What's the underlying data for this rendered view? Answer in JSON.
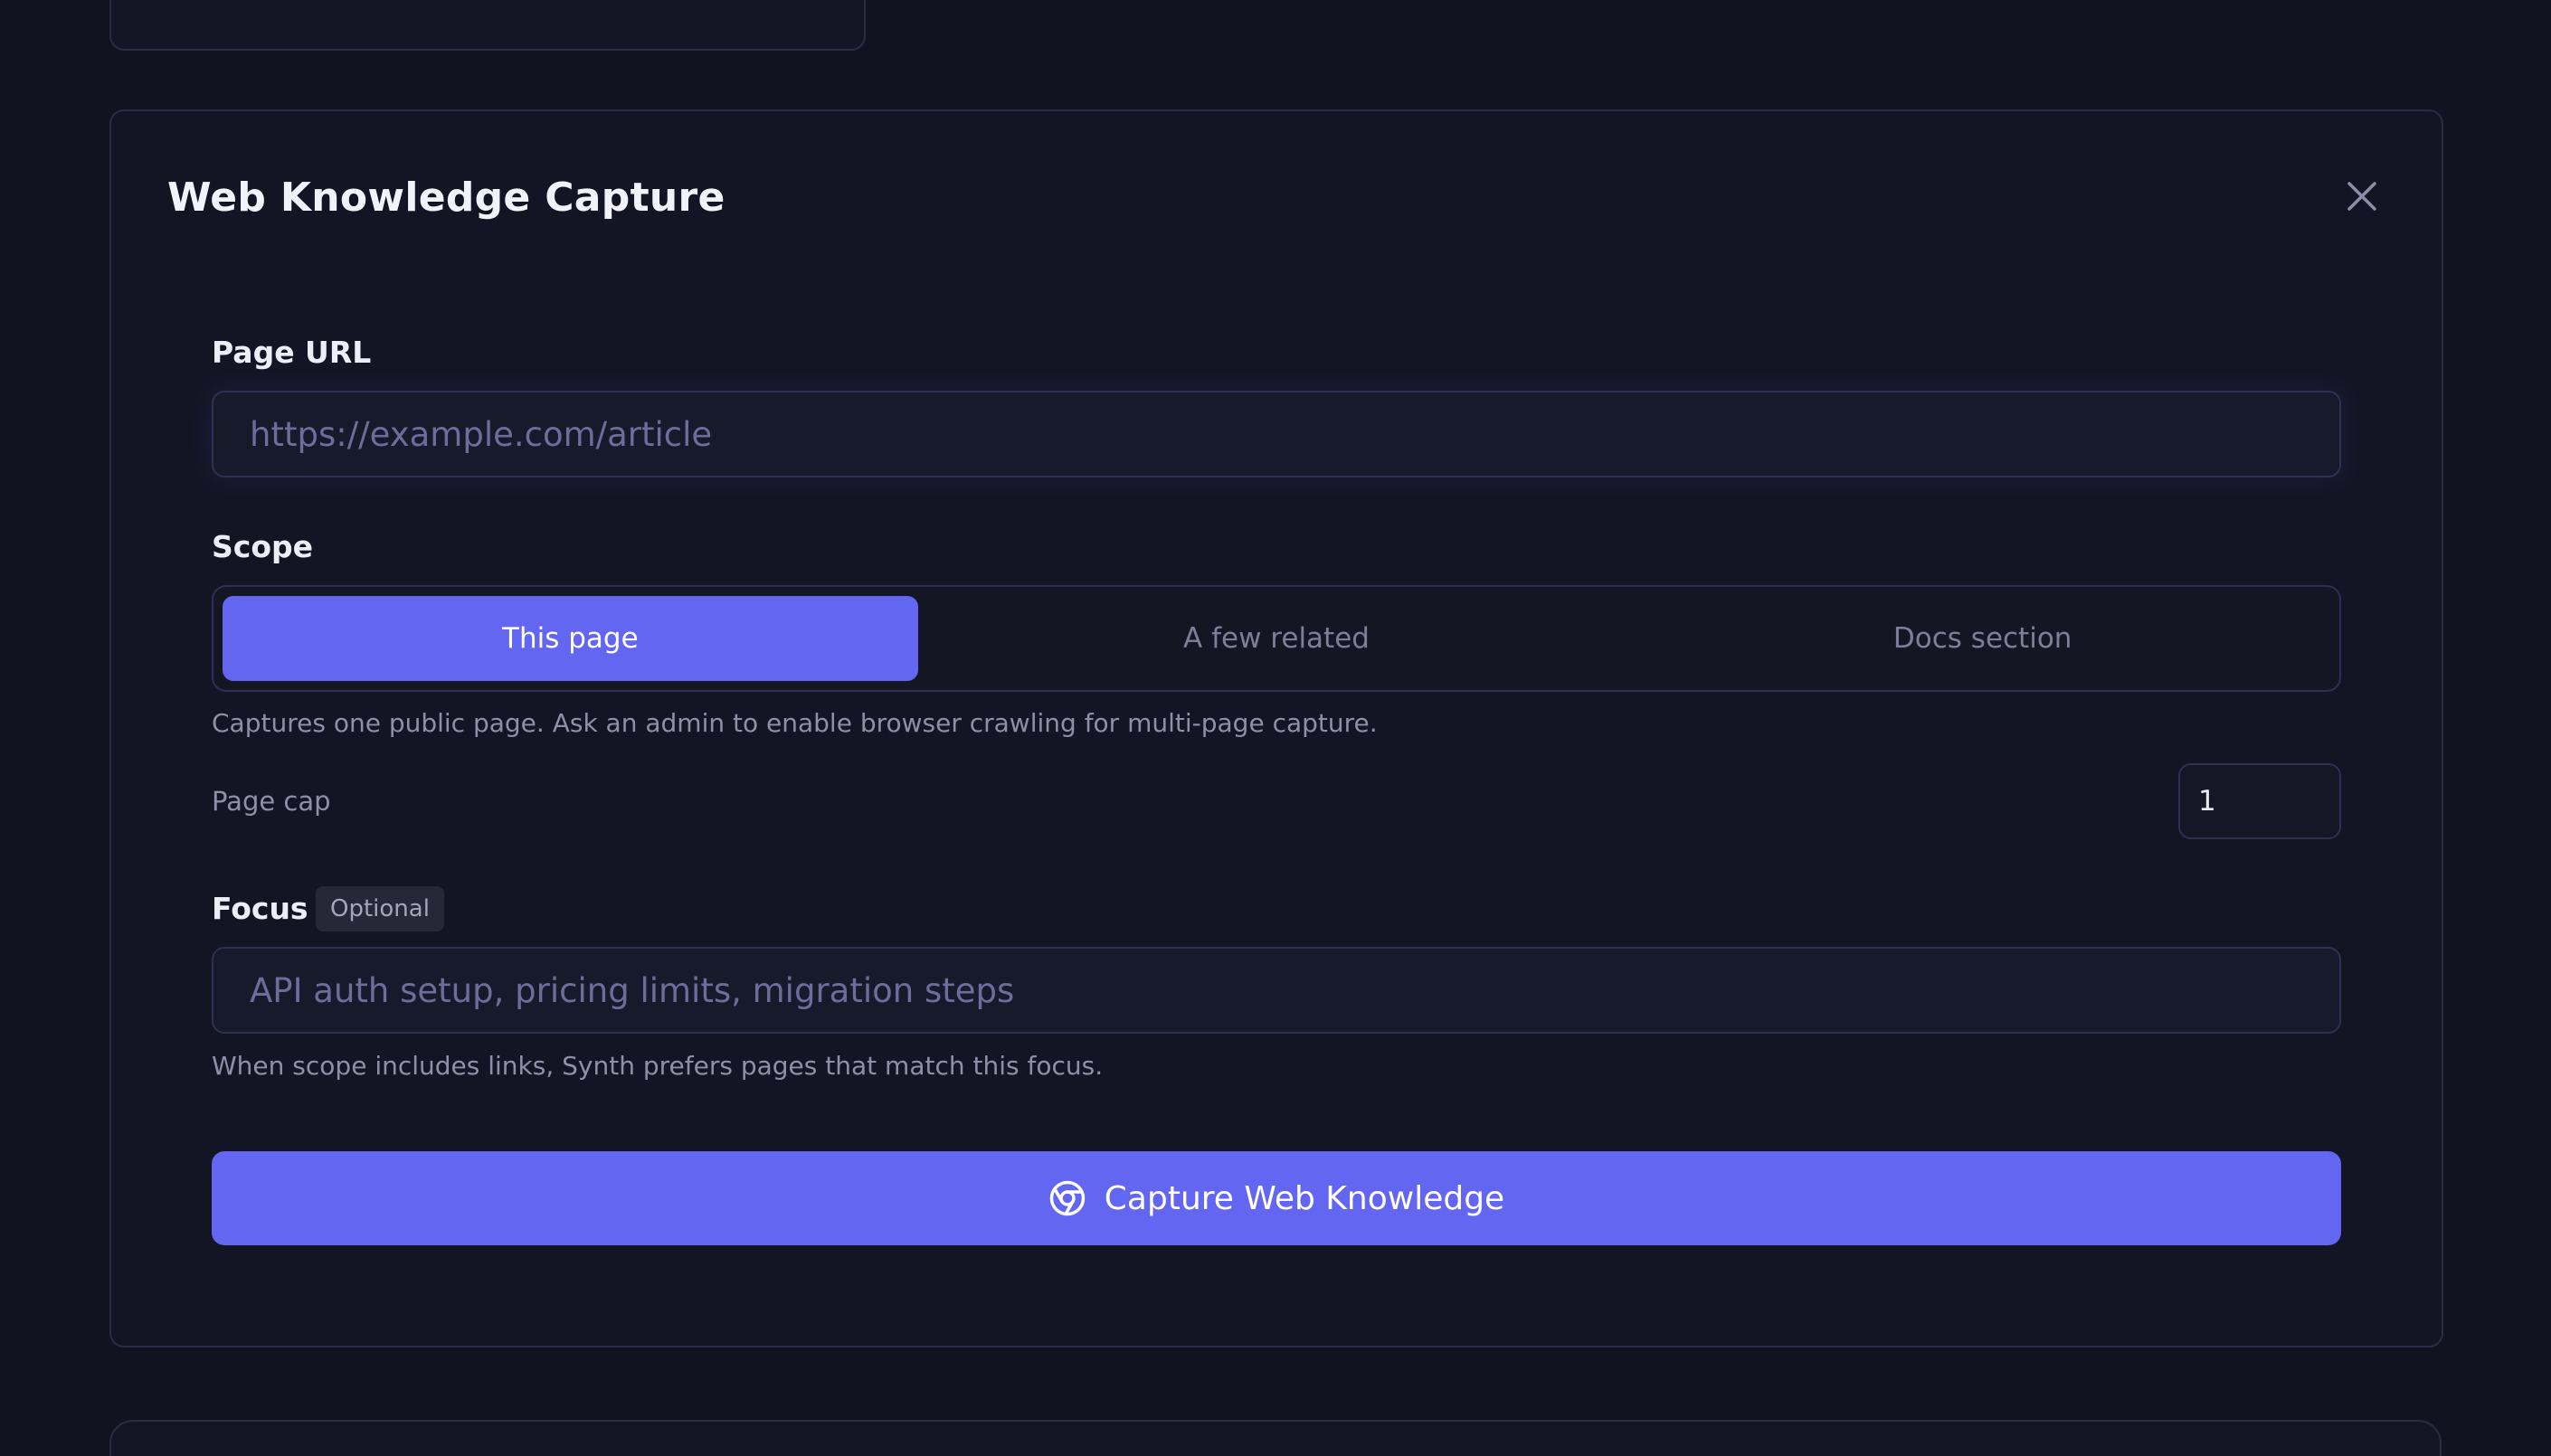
{
  "colors": {
    "background": "#121320",
    "card_border": "#2a2c44",
    "accent": "#6366f1",
    "muted_text": "#8e90a8",
    "placeholder": "#6d6c9a"
  },
  "capture": {
    "title": "Web Knowledge Capture",
    "close_icon": "close-icon",
    "url": {
      "label": "Page URL",
      "placeholder": "https://example.com/article",
      "value": ""
    },
    "scope": {
      "label": "Scope",
      "options": [
        {
          "label": "This page",
          "selected": true
        },
        {
          "label": "A few related",
          "selected": false
        },
        {
          "label": "Docs section",
          "selected": false
        }
      ],
      "help": "Captures one public page. Ask an admin to enable browser crawling for multi-page capture."
    },
    "page_cap": {
      "label": "Page cap",
      "value": "1"
    },
    "focus": {
      "label": "Focus",
      "badge": "Optional",
      "placeholder": "API auth setup, pricing limits, migration steps",
      "value": "",
      "help": "When scope includes links, Synth prefers pages that match this focus."
    },
    "submit": {
      "label": "Capture Web Knowledge",
      "icon": "chrome-icon"
    }
  }
}
